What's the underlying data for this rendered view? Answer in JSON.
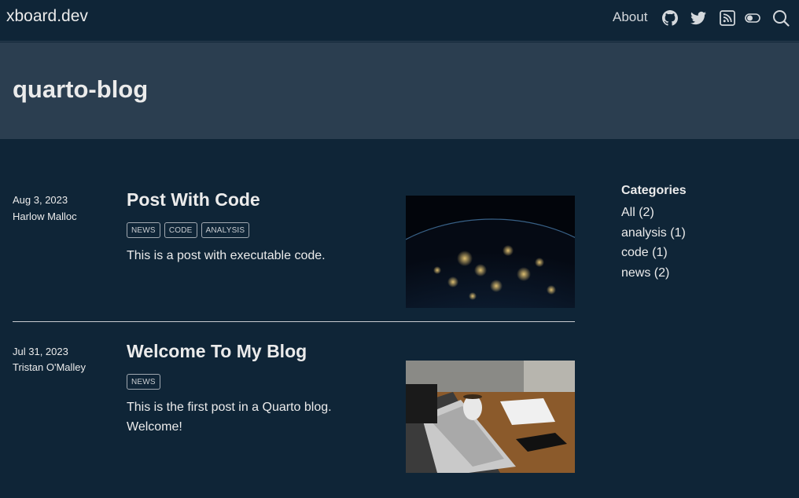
{
  "navbar": {
    "brand": "xboard.dev",
    "about_label": "About",
    "icons": [
      "github-icon",
      "twitter-icon",
      "rss-icon",
      "toggle-icon",
      "search-icon"
    ]
  },
  "page": {
    "title": "quarto-blog"
  },
  "posts": [
    {
      "date": "Aug 3, 2023",
      "author": "Harlow Malloc",
      "title": "Post With Code",
      "tags": [
        "NEWS",
        "CODE",
        "ANALYSIS"
      ],
      "description": "This is a post with executable code.",
      "image": "earth-at-night"
    },
    {
      "date": "Jul 31, 2023",
      "author": "Tristan O'Malley",
      "title": "Welcome To My Blog",
      "tags": [
        "NEWS"
      ],
      "description": "This is the first post in a Quarto blog. Welcome!",
      "image": "laptop-on-desk"
    }
  ],
  "sidebar": {
    "title": "Categories",
    "items": [
      {
        "label": "All (2)"
      },
      {
        "label": "analysis (1)"
      },
      {
        "label": "code (1)"
      },
      {
        "label": "news (2)"
      }
    ]
  },
  "colors": {
    "background": "#0f2537",
    "banner": "#2b3e50",
    "text": "#ebebeb"
  }
}
